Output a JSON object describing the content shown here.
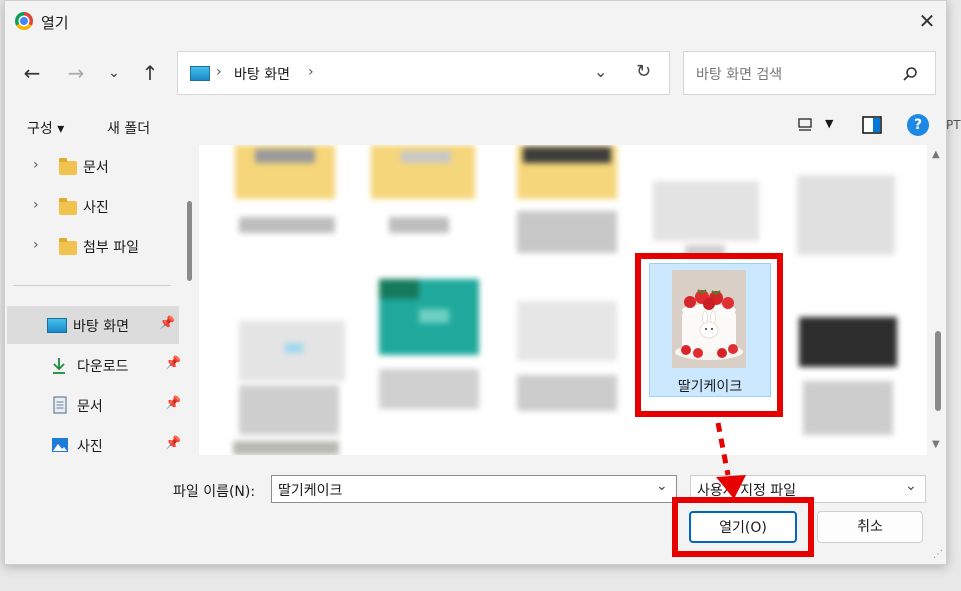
{
  "window": {
    "title": "열기",
    "app_icon": "chrome-icon"
  },
  "address_bar": {
    "path": [
      "바탕 화면"
    ],
    "separator": "›"
  },
  "search": {
    "placeholder": "바탕 화면 검색"
  },
  "toolbar": {
    "organize": "구성",
    "new_folder": "새 폴더"
  },
  "nav": {
    "items": [
      {
        "label": "문서",
        "type": "folder",
        "expandable": true
      },
      {
        "label": "사진",
        "type": "folder",
        "expandable": true
      },
      {
        "label": "첨부 파일",
        "type": "folder",
        "expandable": true
      },
      {
        "label": "바탕 화면",
        "type": "desktop",
        "pinned": true,
        "selected": true
      },
      {
        "label": "다운로드",
        "type": "download",
        "pinned": true
      },
      {
        "label": "문서",
        "type": "document",
        "pinned": true
      },
      {
        "label": "사진",
        "type": "picture",
        "pinned": true
      }
    ]
  },
  "files": {
    "selected_label": "딸기케이크"
  },
  "footer": {
    "filename_label": "파일 이름(N):",
    "filename_value": "딸기케이크",
    "filetype_value": "사용자 지정 파일",
    "open_button": "열기(O)",
    "cancel_button": "취소"
  },
  "colors": {
    "annotation": "#e60000",
    "selection": "#cce8ff",
    "accent": "#0067c0"
  }
}
